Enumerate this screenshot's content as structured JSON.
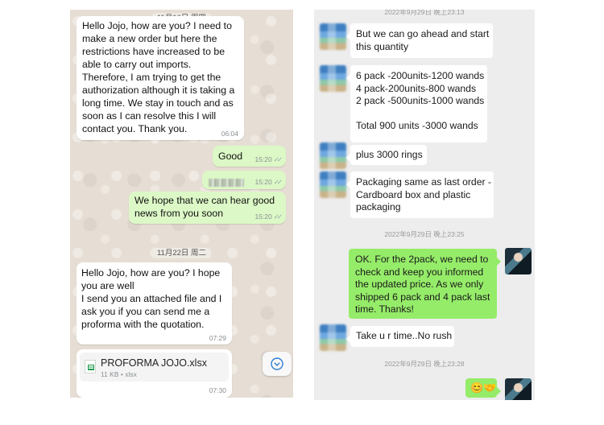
{
  "whatsapp": {
    "date1": "11月10日 周四",
    "msg1": {
      "text": "Hello Jojo, how are you?  I need to make a new order but here the restrictions have increased to be able to carry out imports.\nTherefore, I am trying to get the authorization although it is taking a long time.  We stay in touch and as soon as I can resolve this I will contact you.  Thank you.",
      "time": "06:04"
    },
    "msg2": {
      "text": "Good",
      "time": "15:20"
    },
    "msg3": {
      "time": "15:20"
    },
    "msg4": {
      "text": "We hope that we can hear good news from you soon",
      "time": "15:20"
    },
    "date2": "11月22日 周二",
    "msg5": {
      "text": "Hello Jojo, how are you?  I hope you are well\nI send you an attached file and I ask you if you can send me a proforma with the quotation.",
      "time": "07:29"
    },
    "file": {
      "name": "PROFORMA JOJO.xlsx",
      "meta": "11 KB • xlsx",
      "time": "07:30"
    },
    "ticks": "✓✓"
  },
  "wechat": {
    "time_top": "2022年9月29日 晚上23:13",
    "m1": "But we can go ahead and start this quantity",
    "m2": "6 pack -200units-1200 wands\n4 pack-200units-800 wands\n2 pack -500units-1000 wands\n\nTotal 900 units -3000 wands",
    "m3": "plus 3000 rings",
    "m4": "Packaging same as last order - Cardboard box and plastic packaging",
    "time2": "2022年9月29日 晚上23:25",
    "m5": "OK. For the 2pack, we need to check and keep you informed the updated price. As we only shipped 6 pack and 4 pack last time. Thanks!",
    "m6": "Take u r time..No rush",
    "time3": "2022年9月29日 晚上23:28",
    "m7": "😊🤝"
  }
}
